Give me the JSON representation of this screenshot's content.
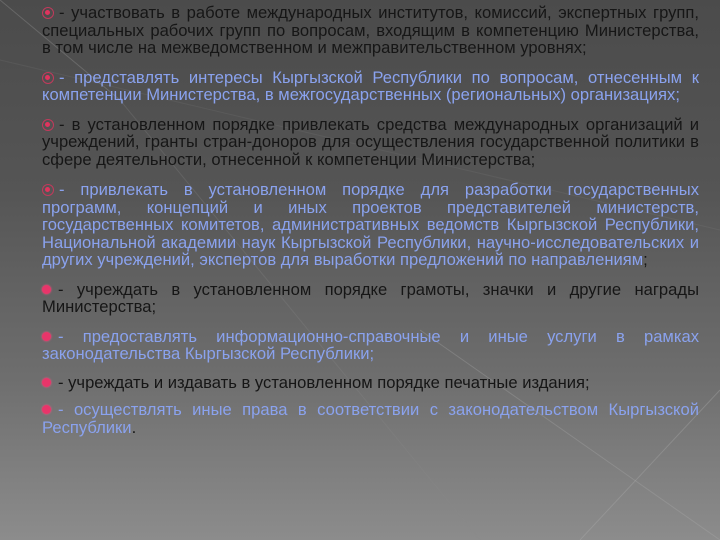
{
  "colors": {
    "text_dark": "#161616",
    "text_blue": "#8aa2ee",
    "bullet": "#e0345e"
  },
  "items": [
    {
      "icon": "target-bullet-icon",
      "style": "dark",
      "text": "- участвовать в работе международных институтов, комиссий, экспертных групп, специальных рабочих групп по вопросам, входящим в компетенцию Министерства, в том числе на межведомственном и межправительственном уровнях;"
    },
    {
      "icon": "target-bullet-icon",
      "style": "blue",
      "text": "- представлять интересы Кыргызской Республики по вопросам, отнесенным к компетенции Министерства, в межгосударственных (региональных) организациях;"
    },
    {
      "icon": "target-bullet-icon",
      "style": "dark",
      "text": "- в установленном порядке привлекать средства международных организаций и учреждений, гранты стран-доноров для осуществления государственной политики в сфере деятельности, отнесенной к компетенции Министерства;"
    },
    {
      "icon": "target-bullet-icon",
      "style": "blue",
      "text": "- привлекать в установленном порядке для разработки государственных программ, концепций и иных проектов представителей министерств, государственных комитетов, административных ведомств Кыргызской Республики, Национальной академии наук Кыргызской Республики, научно-исследовательских и других учреждений, экспертов для выработки предложений по направлениям",
      "trailing": ";"
    },
    {
      "icon": "dot-bullet-icon",
      "style": "dark",
      "text": "- учреждать в установленном порядке грамоты, значки и другие награды Министерства;"
    },
    {
      "icon": "dot-bullet-icon",
      "style": "blue",
      "text": "- предоставлять информационно-справочные и иные услуги в рамках законодательства Кыргызской Республики;"
    },
    {
      "icon": "dot-bullet-icon",
      "style": "dark",
      "text": "- учреждать и издавать в установленном порядке печатные издания;"
    },
    {
      "icon": "dot-bullet-icon",
      "style": "blue",
      "text": "- осуществлять иные права в соответствии с законодательством Кыргызской Республики",
      "trailing": "."
    }
  ]
}
